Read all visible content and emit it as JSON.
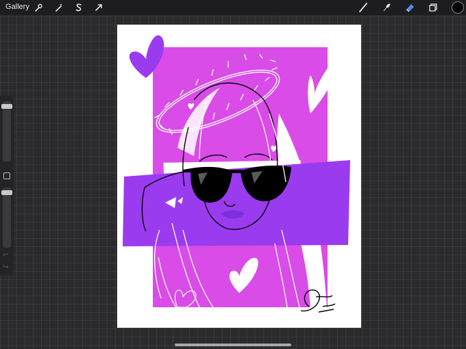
{
  "topbar": {
    "gallery_label": "Gallery",
    "left_tools": [
      {
        "name": "actions",
        "icon": "wrench-icon"
      },
      {
        "name": "adjustments",
        "icon": "magic-wand-icon"
      },
      {
        "name": "selection",
        "icon": "selection-s-icon"
      },
      {
        "name": "transform",
        "icon": "transform-arrow-icon"
      }
    ],
    "right_tools": [
      {
        "name": "brush",
        "icon": "brush-icon"
      },
      {
        "name": "smudge",
        "icon": "smudge-icon"
      },
      {
        "name": "eraser",
        "icon": "eraser-icon",
        "active": true
      },
      {
        "name": "layers",
        "icon": "layers-icon"
      }
    ],
    "active_color": "#000000",
    "active_tool_color": "#4a8df7"
  },
  "sidebar": {
    "sliders": [
      "brush-size",
      "opacity"
    ],
    "modify_button": "square",
    "undo_icon": "undo-icon",
    "redo_icon": "redo-icon"
  },
  "canvas": {
    "background": "#ffffff",
    "colors": {
      "magenta": "#d94ce8",
      "violet": "#9b3bf0",
      "deep_violet": "#7c2fe0",
      "line": "#000000",
      "white": "#ffffff"
    }
  }
}
